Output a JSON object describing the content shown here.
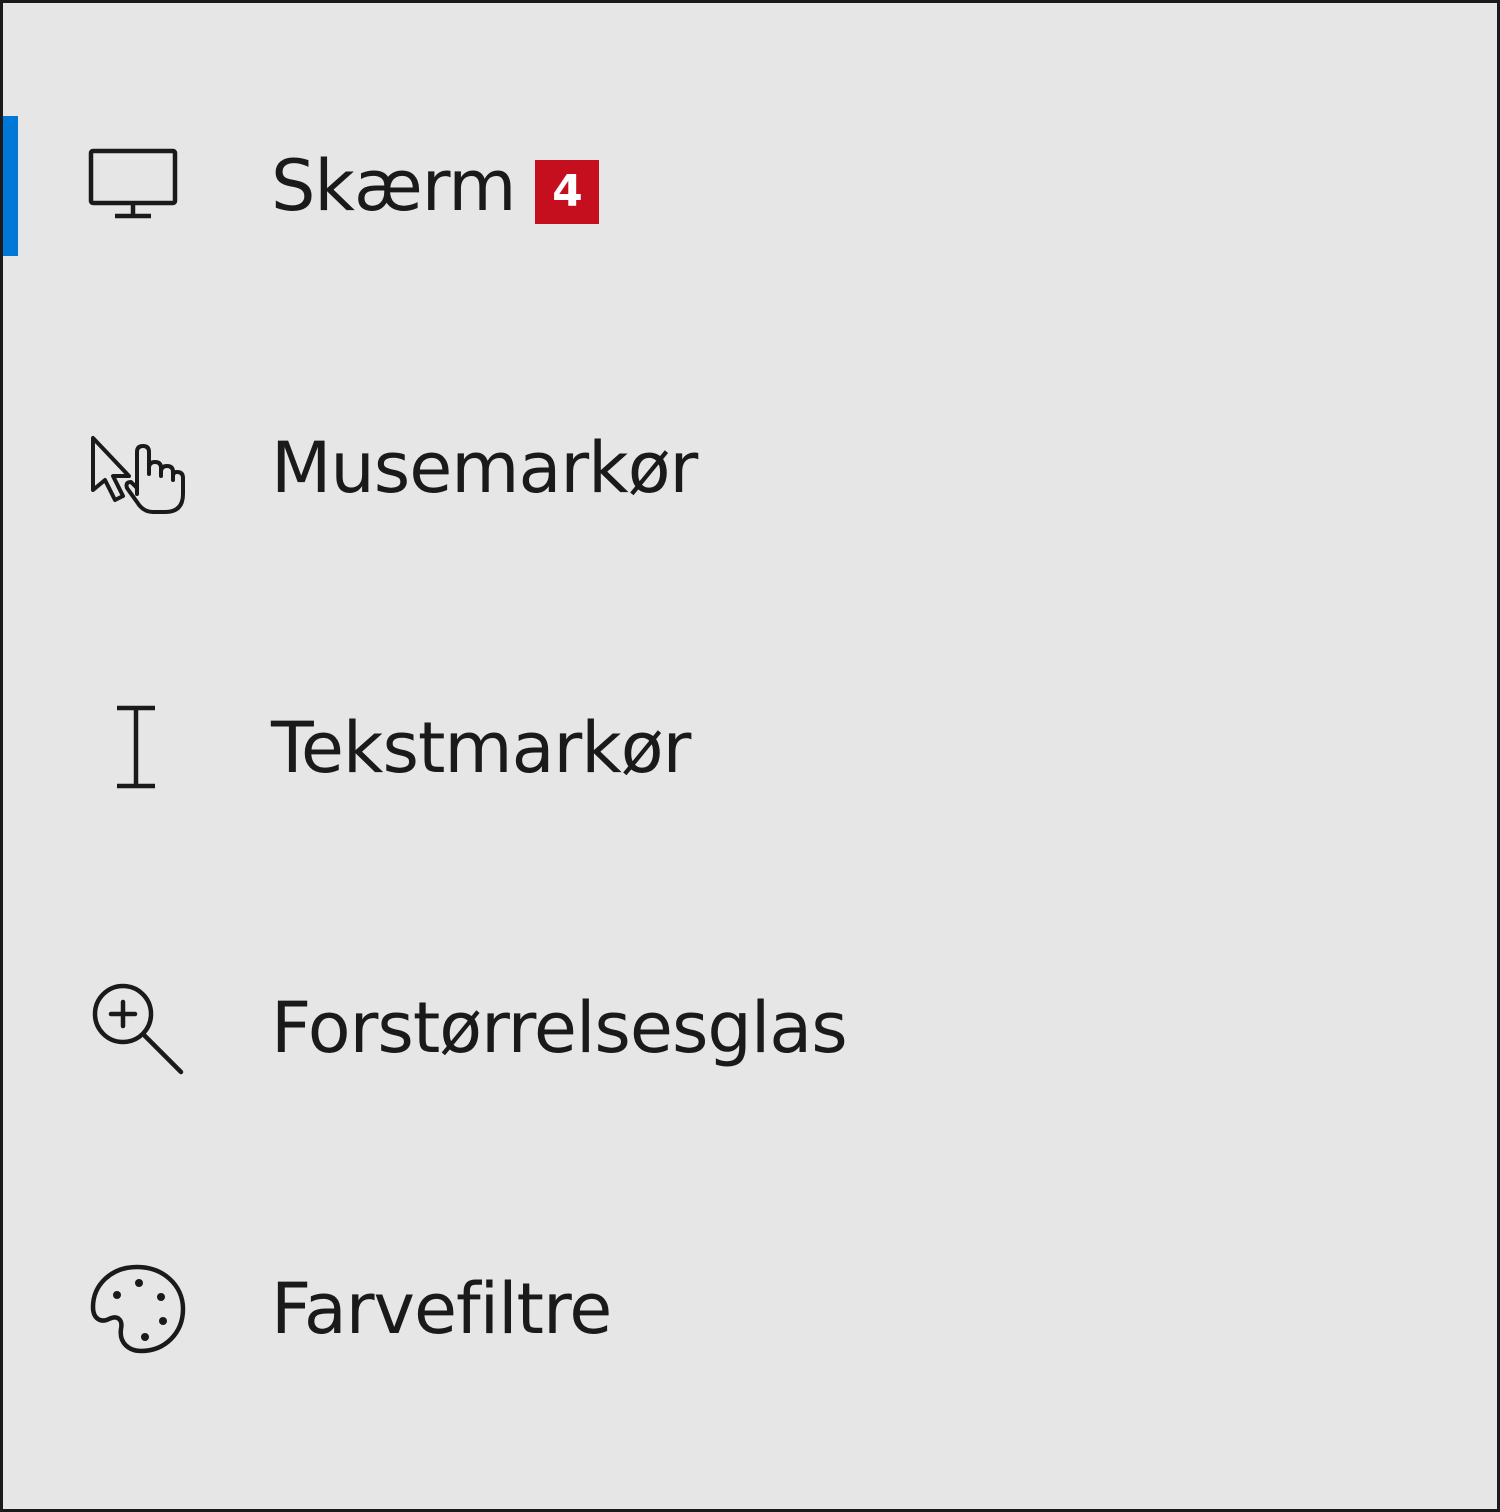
{
  "nav": {
    "items": [
      {
        "label": "Skærm",
        "icon": "monitor-icon",
        "badge": "4",
        "selected": true
      },
      {
        "label": "Musemarkør",
        "icon": "mouse-pointer-icon"
      },
      {
        "label": "Tekstmarkør",
        "icon": "text-cursor-icon"
      },
      {
        "label": "Forstørrelsesglas",
        "icon": "magnifier-icon"
      },
      {
        "label": "Farvefiltre",
        "icon": "palette-icon"
      }
    ]
  },
  "colors": {
    "background": "#e6e6e6",
    "accent": "#0078d7",
    "badge": "#c50f1f",
    "text": "#1a1a1a"
  }
}
